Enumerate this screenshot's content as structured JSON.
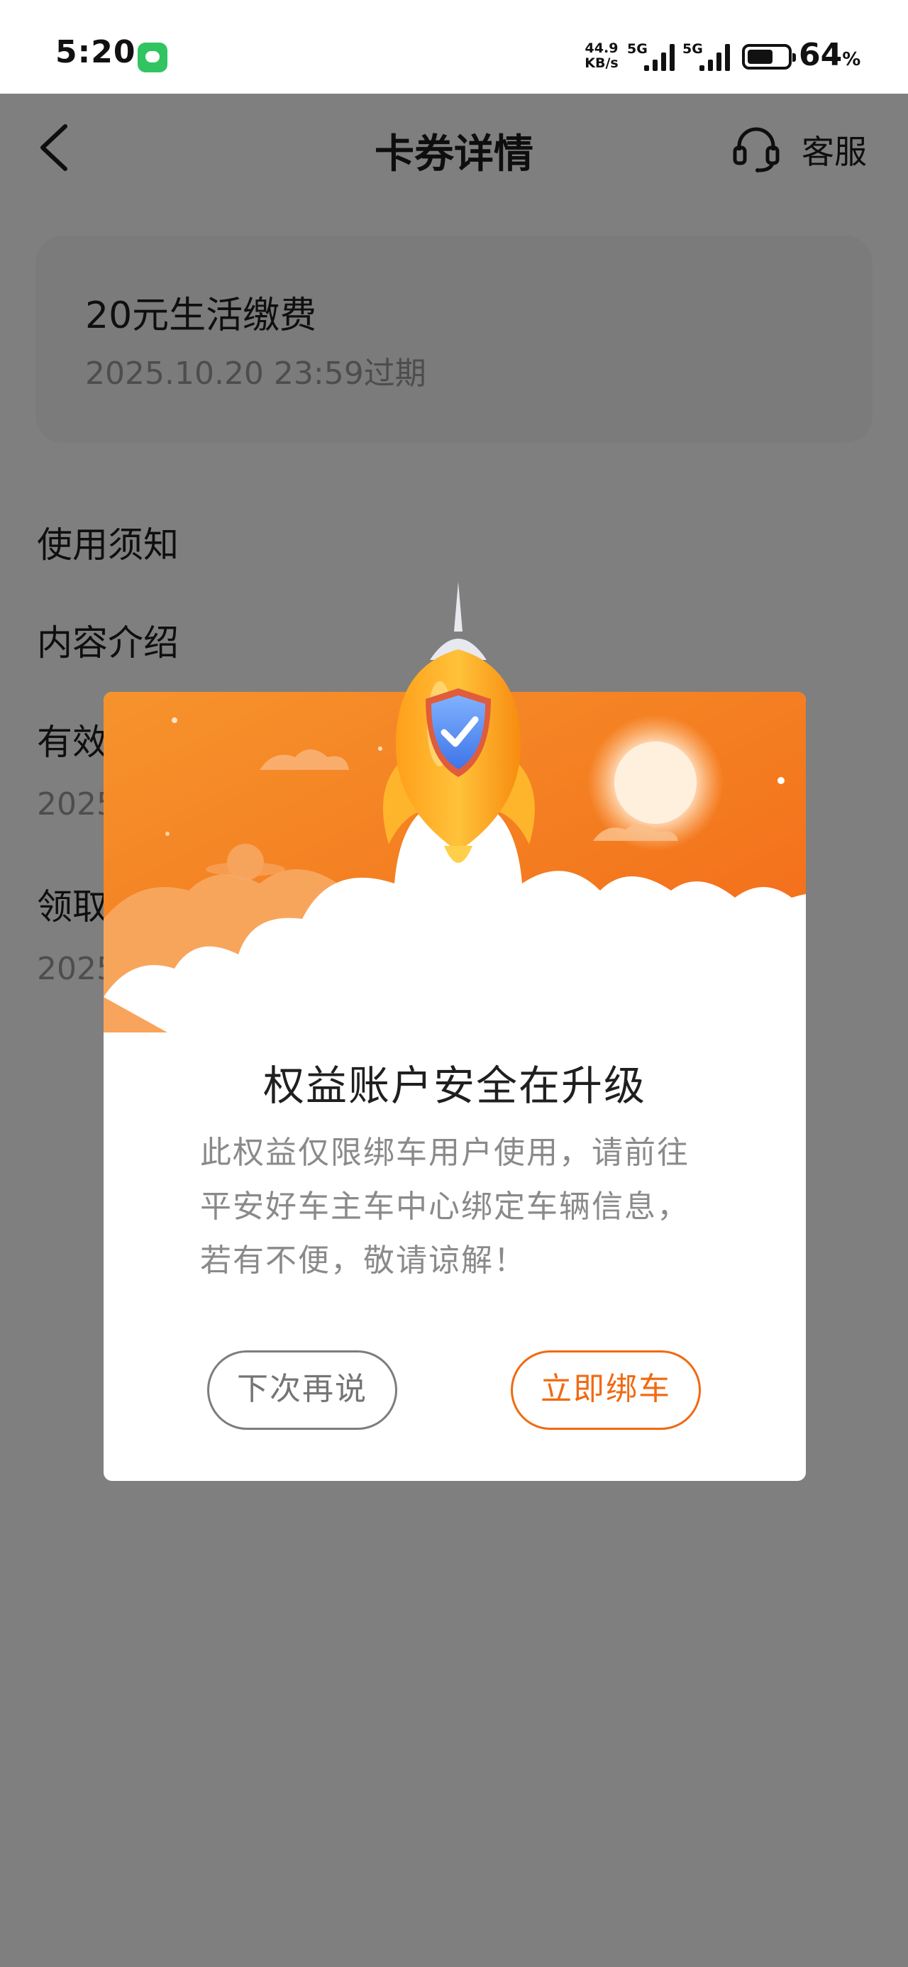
{
  "status_bar": {
    "time": "5:20",
    "net_speed_value": "44.9",
    "net_speed_unit": "KB/s",
    "signal1_label": "5G",
    "signal2_label": "5G",
    "battery_level": 64,
    "battery_text": "64",
    "battery_unit": "%"
  },
  "header": {
    "title": "卡券详情",
    "service_label": "客服"
  },
  "coupon": {
    "name": "20元生活缴费",
    "expiry": "2025.10.20 23:59过期"
  },
  "sections": {
    "usage_notice": "使用须知",
    "content_intro": "内容介绍",
    "validity_label": "有效",
    "validity_value": "2025",
    "claim_label": "领取",
    "claim_value": "2025"
  },
  "dialog": {
    "title": "权益账户安全在升级",
    "line1": "此权益仅限绑车用户使用，请前往",
    "line2": "平安好车主车中心绑定车辆信息，",
    "line3": "若有不便，敬请谅解！",
    "later_button": "下次再说",
    "bind_button": "立即绑车"
  },
  "colors": {
    "accent_orange": "#f06a12",
    "mask": "rgba(0,0,0,0.5)",
    "status_green": "#31c461"
  }
}
